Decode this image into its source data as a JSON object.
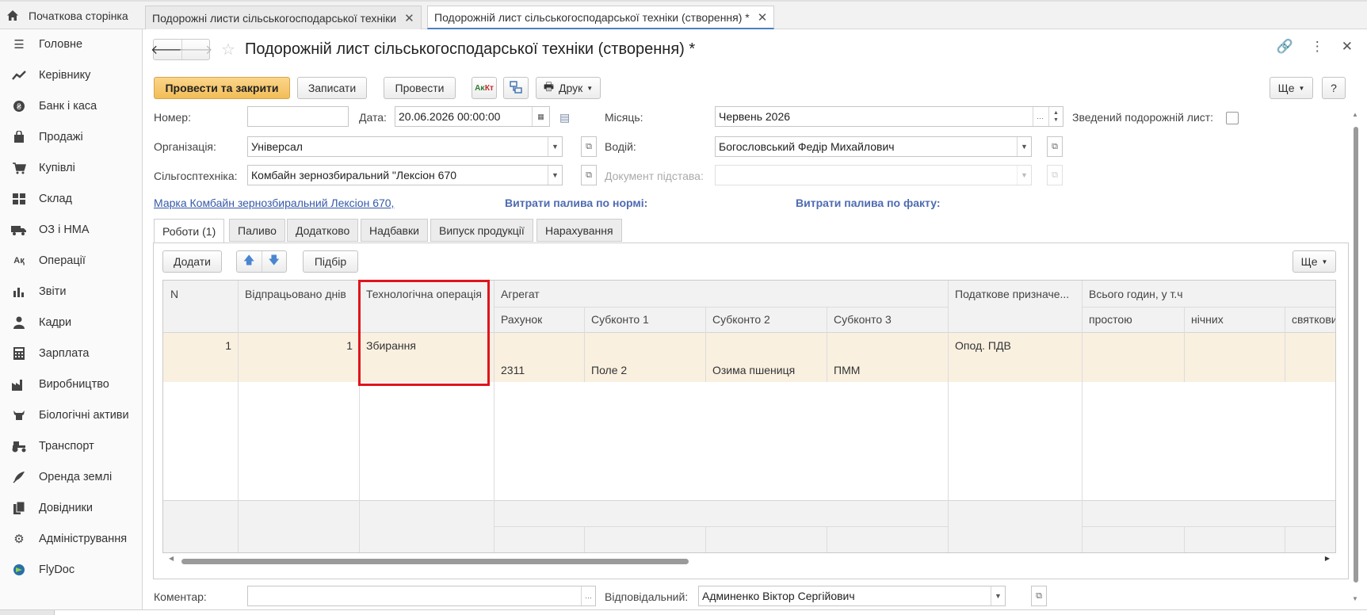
{
  "tabs": {
    "home_label": "Початкова сторінка",
    "tab1_label": "Подорожні листи сільськогосподарської техніки",
    "tab2_label": "Подорожній лист сільськогосподарської техніки (створення) *"
  },
  "sidebar": {
    "items": [
      {
        "label": "Головне",
        "icon": "menu-icon"
      },
      {
        "label": "Керівнику",
        "icon": "trend-icon"
      },
      {
        "label": "Банк і каса",
        "icon": "coin-icon"
      },
      {
        "label": "Продажі",
        "icon": "bag-icon"
      },
      {
        "label": "Купівлі",
        "icon": "cart-icon"
      },
      {
        "label": "Склад",
        "icon": "warehouse-icon"
      },
      {
        "label": "ОЗ і НМА",
        "icon": "truck-icon"
      },
      {
        "label": "Операції",
        "icon": "operations-icon"
      },
      {
        "label": "Звіти",
        "icon": "chart-icon"
      },
      {
        "label": "Кадри",
        "icon": "person-icon"
      },
      {
        "label": "Зарплата",
        "icon": "calculator-icon"
      },
      {
        "label": "Виробництво",
        "icon": "factory-icon"
      },
      {
        "label": "Біологічні активи",
        "icon": "cow-icon"
      },
      {
        "label": "Транспорт",
        "icon": "tractor-icon"
      },
      {
        "label": "Оренда землі",
        "icon": "feather-icon"
      },
      {
        "label": "Довідники",
        "icon": "books-icon"
      },
      {
        "label": "Адміністрування",
        "icon": "gear-icon"
      },
      {
        "label": "FlyDoc",
        "icon": "flydoc-icon"
      }
    ]
  },
  "header": {
    "title": "Подорожній лист сільськогосподарської техніки (створення) *"
  },
  "toolbar": {
    "post_close": "Провести та закрити",
    "save": "Записати",
    "post": "Провести",
    "print": "Друк",
    "more": "Ще",
    "help": "?"
  },
  "form": {
    "number_label": "Номер:",
    "number_value": "",
    "date_label": "Дата:",
    "date_value": "20.06.2026 00:00:00",
    "month_label": "Місяць:",
    "month_value": "Червень 2026",
    "summary_label": "Зведений подорожній лист:",
    "org_label": "Організація:",
    "org_value": "Універсал",
    "driver_label": "Водій:",
    "driver_value": "Богословський Федір Михайлович",
    "machine_label": "Сільгосптехніка:",
    "machine_value": "Комбайн зернозбиральний \"Лексіон 670",
    "basis_label": "Документ підстава:",
    "basis_value": "",
    "brand_link": "Марка Комбайн зернозбиральний Лексіон 670,",
    "fuel_norm": "Витрати палива по нормі:",
    "fuel_fact": "Витрати палива по факту:",
    "comment_label": "Коментар:",
    "comment_value": "",
    "responsible_label": "Відповідальний:",
    "responsible_value": "Админенко Віктор Сергійович"
  },
  "inner_tabs": [
    "Роботи (1)",
    "Паливо",
    "Додатково",
    "Надбавки",
    "Випуск продукції",
    "Нарахування"
  ],
  "grid_toolbar": {
    "add": "Додати",
    "pick": "Підбір",
    "more": "Ще"
  },
  "grid": {
    "headers": {
      "n": "N",
      "days": "Відпрацьовано днів",
      "operation": "Технологічна операція",
      "aggregate": "Агрегат",
      "account": "Рахунок",
      "sub1": "Субконто 1",
      "sub2": "Субконто 2",
      "sub3": "Субконто 3",
      "tax": "Податкове призначе...",
      "hours": "Всього годин, у т.ч",
      "idle": "простою",
      "night": "нічних",
      "holiday": "святкови"
    },
    "row": {
      "n": "1",
      "days": "1",
      "operation": "Збирання",
      "tax": "Опод. ПДВ",
      "account": "2311",
      "sub1": "Поле 2",
      "sub2": "Озима пшениця",
      "sub3": "ПММ"
    }
  },
  "colors": {
    "primary_button": "#f2bd57",
    "row_highlight": "#faf0e0",
    "link": "#3659a7",
    "annotation": "#e0141b"
  }
}
